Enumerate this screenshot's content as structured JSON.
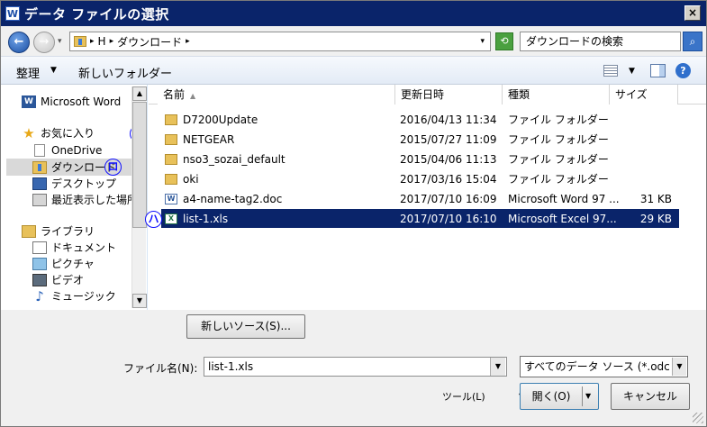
{
  "titlebar": {
    "app_icon": "W",
    "title": "データ ファイルの選択",
    "close_label": "×"
  },
  "address": {
    "back_glyph": "←",
    "forward_glyph": "→",
    "history_glyph": "▾",
    "segments": [
      "H",
      "ダウンロード"
    ],
    "sep_glyph": "▸",
    "dropdown_glyph": "▾",
    "refresh_glyph": "⟲",
    "search_placeholder": "ダウンロードの検索",
    "search_glyph": "⌕"
  },
  "toolbar": {
    "organize": "整理",
    "organize_arrow": "▼",
    "new_folder": "新しいフォルダー",
    "view_arrow": "▼",
    "help": "?"
  },
  "sidebar": {
    "items": [
      {
        "label": "Microsoft Word",
        "icon": "word-icon"
      },
      {
        "label": "お気に入り",
        "icon": "star-icon"
      },
      {
        "label": "OneDrive",
        "icon": "document-icon"
      },
      {
        "label": "ダウンロード",
        "icon": "downloads-folder-icon"
      },
      {
        "label": "デスクトップ",
        "icon": "desktop-icon"
      },
      {
        "label": "最近表示した場所",
        "icon": "recent-places-icon"
      },
      {
        "label": "ライブラリ",
        "icon": "library-icon"
      },
      {
        "label": "ドキュメント",
        "icon": "documents-icon"
      },
      {
        "label": "ピクチャ",
        "icon": "pictures-icon"
      },
      {
        "label": "ビデオ",
        "icon": "video-icon"
      },
      {
        "label": "ミュージック",
        "icon": "music-icon"
      }
    ],
    "word_glyph": "W",
    "star_glyph": "★",
    "music_glyph": "♪",
    "scroll_up": "▲",
    "scroll_down": "▼"
  },
  "markers": {
    "i": "イ",
    "ro": "ロ",
    "ha": "ハ"
  },
  "files": {
    "columns": [
      "名前",
      "更新日時",
      "種類",
      "サイズ"
    ],
    "sort_glyph": "▲",
    "rows": [
      {
        "name": "D7200Update",
        "date": "2016/04/13 11:34",
        "type": "ファイル フォルダー",
        "size": "",
        "icon": "folder-icon"
      },
      {
        "name": "NETGEAR",
        "date": "2015/07/27 11:09",
        "type": "ファイル フォルダー",
        "size": "",
        "icon": "folder-icon"
      },
      {
        "name": "nso3_sozai_default",
        "date": "2015/04/06 11:13",
        "type": "ファイル フォルダー",
        "size": "",
        "icon": "folder-icon"
      },
      {
        "name": "oki",
        "date": "2017/03/16 15:04",
        "type": "ファイル フォルダー",
        "size": "",
        "icon": "folder-icon"
      },
      {
        "name": "a4-name-tag2.doc",
        "date": "2017/07/10 16:09",
        "type": "Microsoft Word 97 ...",
        "size": "31 KB",
        "icon": "word-doc-icon"
      },
      {
        "name": "list-1.xls",
        "date": "2017/07/10 16:10",
        "type": "Microsoft Excel 97...",
        "size": "29 KB",
        "icon": "excel-doc-icon"
      }
    ],
    "word_glyph": "W",
    "excel_glyph": "X"
  },
  "bottom": {
    "new_source": "新しいソース(S)...",
    "filename_label": "ファイル名(N):",
    "filename_value": "list-1.xls",
    "filename_dd": "▼",
    "filter_value": "すべてのデータ ソース (*.odc",
    "filter_dd": "▼",
    "tools": "ツール(L)",
    "tools_arrow": "▼",
    "open": "開く(O)",
    "open_arrow": "▼",
    "cancel": "キャンセル"
  }
}
